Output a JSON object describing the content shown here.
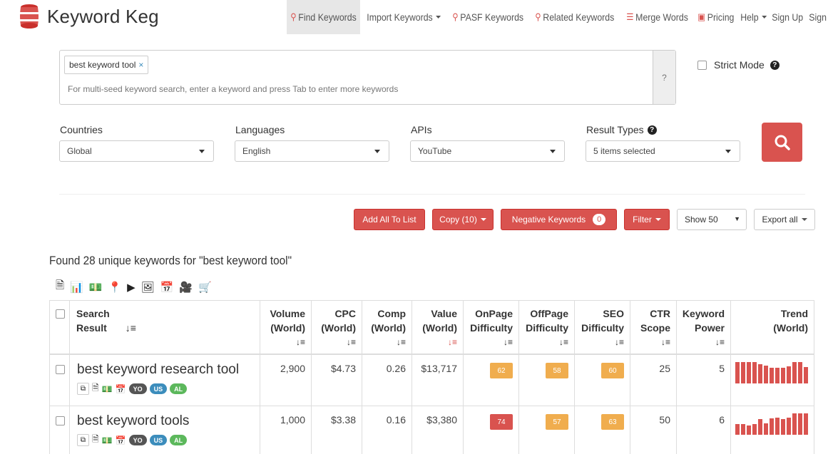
{
  "brand": {
    "name": "Keyword Keg"
  },
  "nav": [
    {
      "label": "Find Keywords",
      "icon": "search-icon",
      "active": true
    },
    {
      "label": "Import Keywords",
      "dropdown": true
    },
    {
      "label": "PASF Keywords",
      "icon": "search-icon"
    },
    {
      "label": "Related Keywords",
      "icon": "search-icon"
    },
    {
      "label": "Merge Words",
      "icon": "list-icon"
    },
    {
      "label": "Pricing",
      "icon": "money-icon"
    },
    {
      "label": "Help",
      "dropdown": true
    },
    {
      "label": "Sign Up"
    },
    {
      "label": "Sign"
    }
  ],
  "seed": {
    "tag": "best keyword tool",
    "tag_remove": "×",
    "hint": "For multi-seed keyword search, enter a keyword and press Tab to enter more keywords",
    "help": "?"
  },
  "strict_mode": {
    "label": "Strict Mode"
  },
  "filters": {
    "countries": {
      "label": "Countries",
      "value": "Global"
    },
    "languages": {
      "label": "Languages",
      "value": "English"
    },
    "apis": {
      "label": "APIs",
      "value": "YouTube"
    },
    "result_types": {
      "label": "Result Types",
      "value": "5 items selected"
    }
  },
  "actions": {
    "add_all": "Add All To List",
    "copy": "Copy (10)",
    "negative": "Negative Keywords",
    "negative_count": "0",
    "filter": "Filter",
    "show": "Show 50",
    "export": "Export all"
  },
  "found_text": "Found 28 unique keywords for \"best keyword tool\"",
  "table": {
    "headers": {
      "search": [
        "Search",
        "Result"
      ],
      "volume": [
        "Volume",
        "(World)"
      ],
      "cpc": [
        "CPC",
        "(World)"
      ],
      "comp": [
        "Comp",
        "(World)"
      ],
      "value": [
        "Value",
        "(World)"
      ],
      "onpage": [
        "OnPage",
        "Difficulty"
      ],
      "offpage": [
        "OffPage",
        "Difficulty"
      ],
      "seo": [
        "SEO",
        "Difficulty"
      ],
      "ctr": [
        "CTR",
        "Scope"
      ],
      "power": [
        "Keyword",
        "Power"
      ],
      "trend": [
        "Trend",
        "(World)"
      ]
    },
    "rows": [
      {
        "keyword": "best keyword research tool",
        "volume": "2,900",
        "cpc": "$4.73",
        "comp": "0.26",
        "value": "$13,717",
        "onpage": "62",
        "offpage": "58",
        "seo": "60",
        "ctr": "25",
        "power": "5",
        "onpage_color": "#f0ad4e",
        "offpage_color": "#f0ad4e",
        "seo_color": "#f0ad4e",
        "tags": [
          "YO",
          "US",
          "AL"
        ],
        "trend": [
          30,
          30,
          30,
          30,
          27,
          25,
          22,
          22,
          22,
          24,
          30,
          30,
          23
        ]
      },
      {
        "keyword": "best keyword tools",
        "volume": "1,000",
        "cpc": "$3.38",
        "comp": "0.16",
        "value": "$3,380",
        "onpage": "74",
        "offpage": "57",
        "seo": "63",
        "ctr": "50",
        "power": "6",
        "onpage_color": "#d9534f",
        "offpage_color": "#f0ad4e",
        "seo_color": "#f0ad4e",
        "tags": [
          "YO",
          "US",
          "AL"
        ],
        "trend": [
          15,
          15,
          13,
          15,
          22,
          16,
          23,
          24,
          22,
          24,
          30,
          30,
          30
        ]
      }
    ]
  }
}
